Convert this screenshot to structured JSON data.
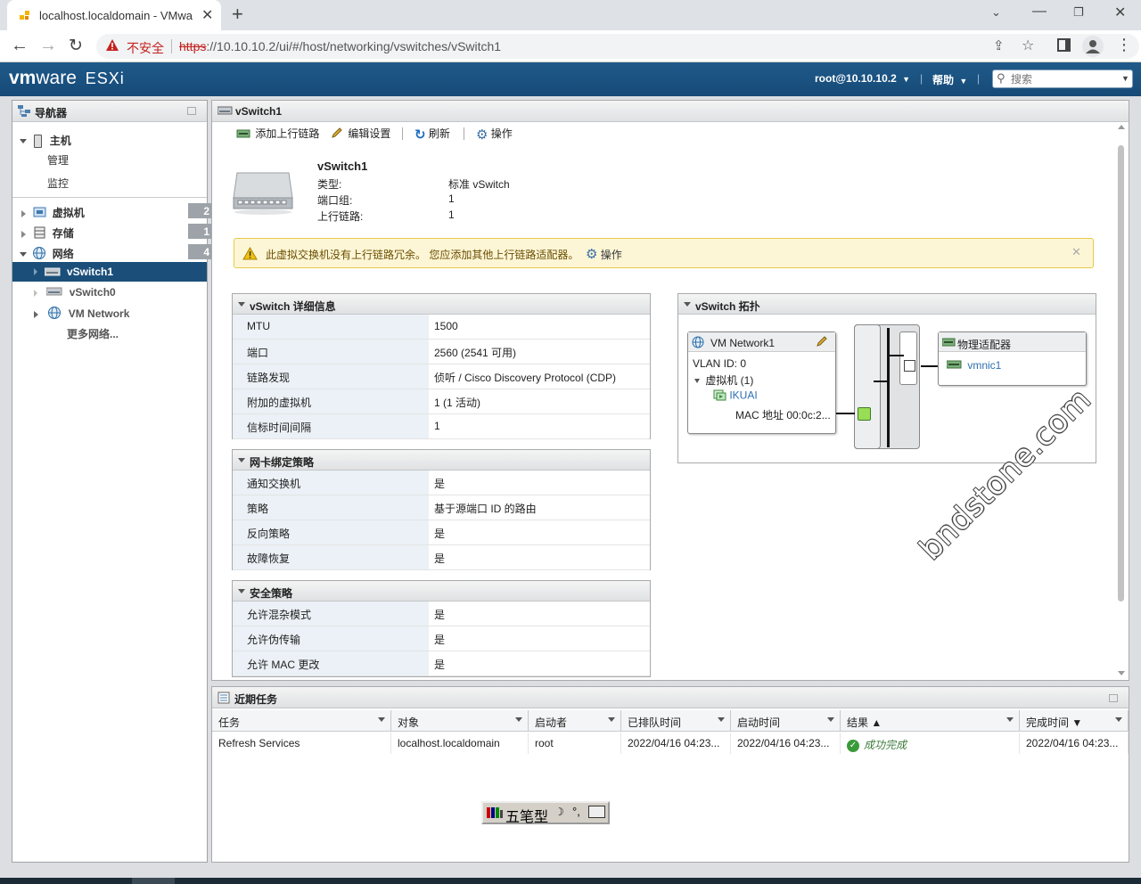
{
  "browser": {
    "tab_title": "localhost.localdomain - VMwa",
    "security_label": "不安全",
    "url_scheme": "https",
    "url_rest": "://10.10.10.2/ui/#/host/networking/vswitches/vSwitch1"
  },
  "header": {
    "logo_vm": "vm",
    "logo_ware": "ware",
    "logo_esxi": "ESXi",
    "user": "root@10.10.10.2",
    "help": "帮助",
    "search_placeholder": "搜索"
  },
  "navigator": {
    "title": "导航器",
    "host": "主机",
    "manage": "管理",
    "monitor": "监控",
    "vms": {
      "label": "虚拟机",
      "count": "2"
    },
    "storage": {
      "label": "存储",
      "count": "1"
    },
    "network": {
      "label": "网络",
      "count": "4"
    },
    "vswitch1": "vSwitch1",
    "vswitch0": "vSwitch0",
    "vm_network": "VM Network",
    "more_networks": "更多网络..."
  },
  "main": {
    "title": "vSwitch1",
    "actions": {
      "add_uplink": "添加上行链路",
      "edit": "编辑设置",
      "refresh": "刷新",
      "actions": "操作"
    },
    "summary": {
      "name": "vSwitch1",
      "type_label": "类型:",
      "type_value": "标准 vSwitch",
      "portgroups_label": "端口组:",
      "portgroups_value": "1",
      "uplinks_label": "上行链路:",
      "uplinks_value": "1"
    },
    "warning": {
      "text": "此虚拟交换机没有上行链路冗余。 您应添加其他上行链路适配器。",
      "action": "操作"
    },
    "details": {
      "title": "vSwitch 详细信息",
      "rows": [
        {
          "k": "MTU",
          "v": "1500"
        },
        {
          "k": "端口",
          "v": "2560 (2541 可用)"
        },
        {
          "k": "链路发现",
          "v": "侦听 / Cisco Discovery Protocol (CDP)"
        },
        {
          "k": "附加的虚拟机",
          "v": "1 (1 活动)"
        },
        {
          "k": "信标时间间隔",
          "v": "1"
        }
      ]
    },
    "teaming": {
      "title": "网卡绑定策略",
      "rows": [
        {
          "k": "通知交换机",
          "v": "是"
        },
        {
          "k": "策略",
          "v": "基于源端口 ID 的路由"
        },
        {
          "k": "反向策略",
          "v": "是"
        },
        {
          "k": "故障恢复",
          "v": "是"
        }
      ]
    },
    "security": {
      "title": "安全策略",
      "rows": [
        {
          "k": "允许混杂模式",
          "v": "是"
        },
        {
          "k": "允许伪传输",
          "v": "是"
        },
        {
          "k": "允许 MAC 更改",
          "v": "是"
        }
      ]
    },
    "topology": {
      "title": "vSwitch 拓扑",
      "portgroup": "VM Network1",
      "vlan": "VLAN ID: 0",
      "vms": "虚拟机 (1)",
      "vm_name": "IKUAI",
      "mac": "MAC 地址 00:0c:2...",
      "physical": "物理适配器",
      "nic": "vmnic1"
    }
  },
  "watermark": "bndstone.com",
  "tasks": {
    "title": "近期任务",
    "columns": [
      "任务",
      "对象",
      "启动者",
      "已排队时间",
      "启动时间",
      "结果 ▲",
      "完成时间 ▼"
    ],
    "rows": [
      [
        "Refresh Services",
        "localhost.localdomain",
        "root",
        "2022/04/16 04:23...",
        "2022/04/16 04:23...",
        "成功完成",
        "2022/04/16 04:23..."
      ]
    ]
  },
  "ime": {
    "mode": "五笔型"
  },
  "colors": {
    "header_blue": "#1a5282",
    "selected_nav": "#1b4f7a",
    "warning_bg": "#fdf6d6",
    "success": "#3a8a3a"
  }
}
